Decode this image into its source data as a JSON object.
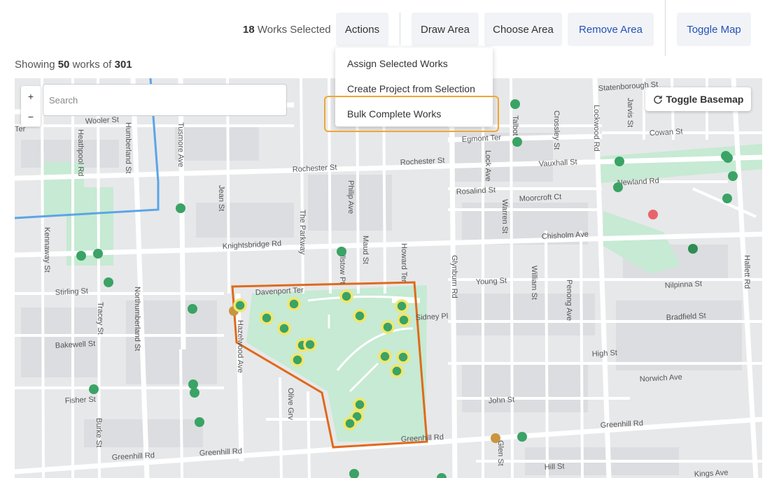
{
  "toolbar": {
    "selected_count": "18",
    "selected_suffix": "Works Selected",
    "actions_label": "Actions",
    "draw_area_label": "Draw Area",
    "choose_area_label": "Choose Area",
    "remove_area_label": "Remove Area",
    "toggle_map_label": "Toggle Map"
  },
  "summary": {
    "prefix": "Showing",
    "shown": "50",
    "middle": "works of",
    "total": "301"
  },
  "actions_menu": {
    "items": [
      "Assign Selected Works",
      "Create Project from Selection",
      "Bulk Complete Works"
    ],
    "highlighted": "Bulk Complete Works"
  },
  "map": {
    "search_placeholder": "Search",
    "zoom_in": "+",
    "zoom_out": "−",
    "toggle_basemap_label": "Toggle Basemap",
    "streets": [
      "Statenborough St",
      "Wooler St",
      "Heathpool Rd",
      "Humberland St",
      "Tusmore Ave",
      "Jean St",
      "Rochester St",
      "Philip Ave",
      "The Parkway",
      "Maud St",
      "Howard Ter",
      "Glynburn Rd",
      "Talbot St",
      "Crossley St",
      "Lockwood Rd",
      "Jarvis St",
      "Cowan St",
      "Egmont Ter",
      "Vauxhall St",
      "Lock Ave",
      "Rosalind St",
      "Warren St",
      "Moorcroft Ct",
      "Newland Rd",
      "Knightsbridge Rd",
      "Chisholm Ave",
      "Kennaway St",
      "Stirling St",
      "Tracey St",
      "Northumberland St",
      "Davenport Ter",
      "Hillstow Pt",
      "Young St",
      "William St",
      "Penong Ave",
      "Nilpinna St",
      "Hallett Rd",
      "Sidney Pl",
      "Bradfield St",
      "Hazelwood Ave",
      "Bakewell St",
      "High St",
      "Olive Grv",
      "Norwich Ave",
      "Fisher St",
      "Burke St",
      "John St",
      "Greenhill Rd",
      "Glen St",
      "Hill St",
      "Kings Ave",
      "Ter"
    ],
    "colors": {
      "work_green": "#3aa365",
      "selected_ring": "#f2e66a",
      "warning": "#c9953e",
      "alert": "#e8646b",
      "selection_polygon": "#e06a1b",
      "boundary_line": "#5aa5e6",
      "park": "#c6ead3",
      "highlight": "#f0a630"
    }
  }
}
